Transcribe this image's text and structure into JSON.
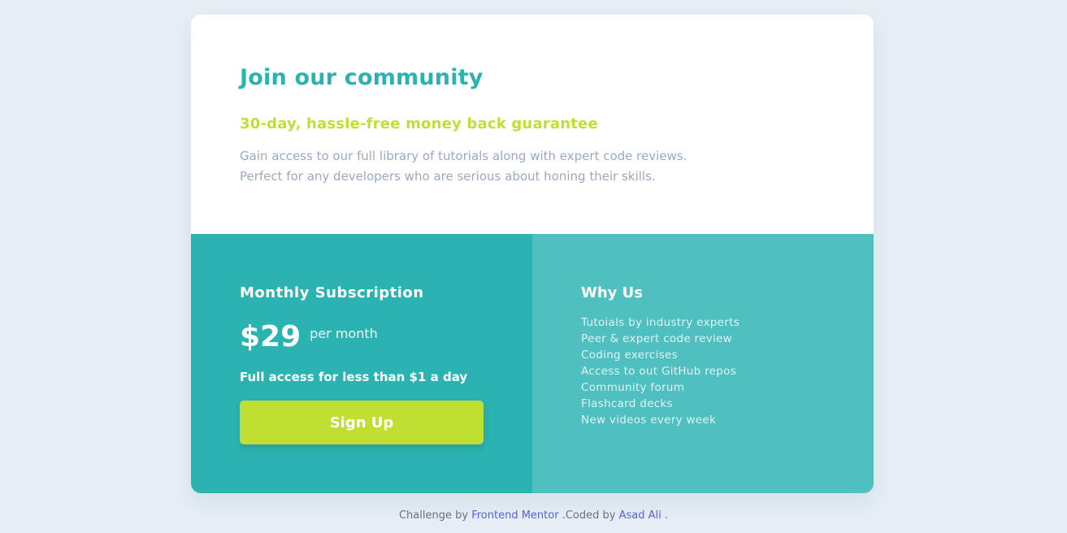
{
  "top": {
    "title": "Join our community",
    "subtitle": "30-day, hassle-free money back guarantee",
    "description_lines": [
      "Gain access to our full library of tutorials along with expert code reviews.",
      "Perfect for any developers who are serious about honing their skills."
    ]
  },
  "subscription": {
    "heading": "Monthly Subscription",
    "price": "$29",
    "period": "per month",
    "tagline": "Full access for less than $1 a day",
    "signup_label": "Sign Up"
  },
  "why_us": {
    "heading": "Why Us",
    "items": [
      "Tutoials by industry experts",
      "Peer & expert code review",
      "Coding exercises",
      "Access to out GitHub repos",
      "Community forum",
      "Flashcard decks",
      "New videos every week"
    ]
  },
  "attribution": {
    "prefix": "Challenge by",
    "link1": "Frontend Mentor",
    "middle": ".Coded by",
    "link2": "Asad Ali",
    "suffix": "."
  },
  "colors": {
    "page_bg": "#e5edf5",
    "accent_teal": "#2bb3b1",
    "light_teal": "#4fbfbf",
    "lime": "#bfe032",
    "muted_text": "#9aa9c0"
  }
}
